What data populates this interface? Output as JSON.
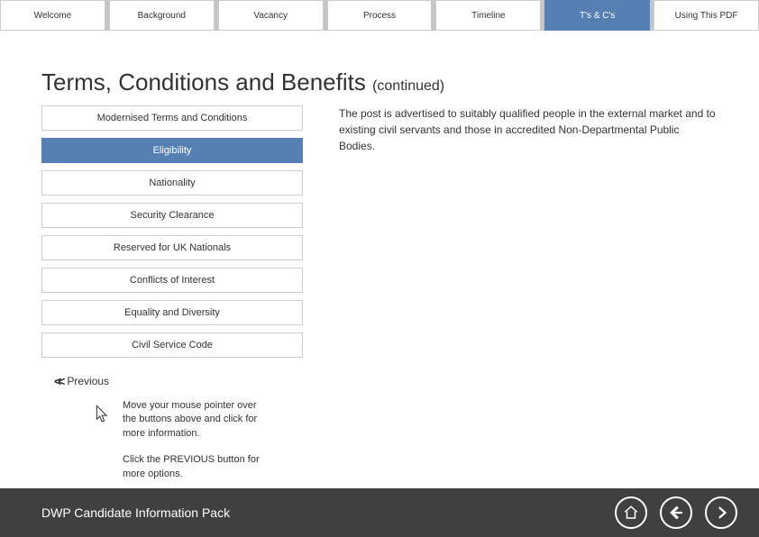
{
  "topnav": {
    "items": [
      {
        "label": "Welcome"
      },
      {
        "label": "Background"
      },
      {
        "label": "Vacancy"
      },
      {
        "label": "Process"
      },
      {
        "label": "Timeline"
      },
      {
        "label": "T's & C's"
      },
      {
        "label": "Using This PDF"
      }
    ]
  },
  "page": {
    "title_main": "Terms, Conditions and Benefits ",
    "title_continued": "(continued)"
  },
  "sidebar": {
    "items": [
      {
        "label": "Modernised Terms and Conditions"
      },
      {
        "label": "Eligibility"
      },
      {
        "label": "Nationality"
      },
      {
        "label": "Security Clearance"
      },
      {
        "label": "Reserved for UK Nationals"
      },
      {
        "label": "Conflicts of Interest"
      },
      {
        "label": "Equality and Diversity"
      },
      {
        "label": "Civil Service Code"
      }
    ]
  },
  "body": {
    "text": "The post is advertised to suitably qualified people in the external market and to existing civil servants and those in accredited Non-Departmental Public Bodies."
  },
  "previous": {
    "label": "Previous"
  },
  "help": {
    "line1": "Move your mouse pointer over the buttons above and click for more information.",
    "line2": "Click the PREVIOUS button for more options."
  },
  "footer": {
    "title": "DWP Candidate Information Pack"
  }
}
